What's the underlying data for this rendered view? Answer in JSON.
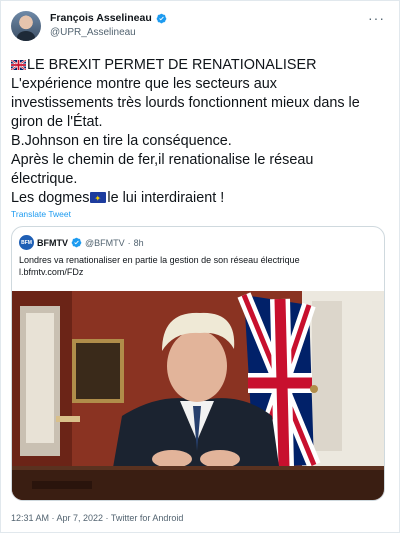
{
  "author": {
    "display_name": "François Asselineau",
    "handle": "@UPR_Asselineau",
    "verified": true
  },
  "tweet": {
    "lines": [
      "LE BREXIT PERMET DE RENATIONALISER",
      "L'expérience montre que les secteurs aux",
      "investissements très lourds fonctionnent mieux dans le",
      "giron de l'État.",
      "B.Johnson en tire la conséquence.",
      "Après le chemin de fer,il renationalise le réseau",
      "électrique.",
      "Les dogmes",
      "le lui interdiraient !"
    ],
    "translate_label": "Translate Tweet"
  },
  "quoted": {
    "avatar_text": "BFM",
    "display_name": "BFMTV",
    "handle": "@BFMTV",
    "separator": "·",
    "time": "8h",
    "text_line1": "Londres va renationaliser en partie la gestion de son réseau électrique",
    "text_line2": "l.bfmtv.com/FDz"
  },
  "meta": {
    "timestamp": "12:31 AM · Apr 7, 2022 · Twitter for Android"
  },
  "icons": {
    "verified": "verified-badge-icon",
    "more": "more-options-icon",
    "uk_flag": "uk-flag-emoji",
    "eu_flag": "eu-flag-emoji"
  },
  "colors": {
    "link": "#1d9bf0",
    "secondary_text": "#536471",
    "border": "#cfd9de"
  }
}
